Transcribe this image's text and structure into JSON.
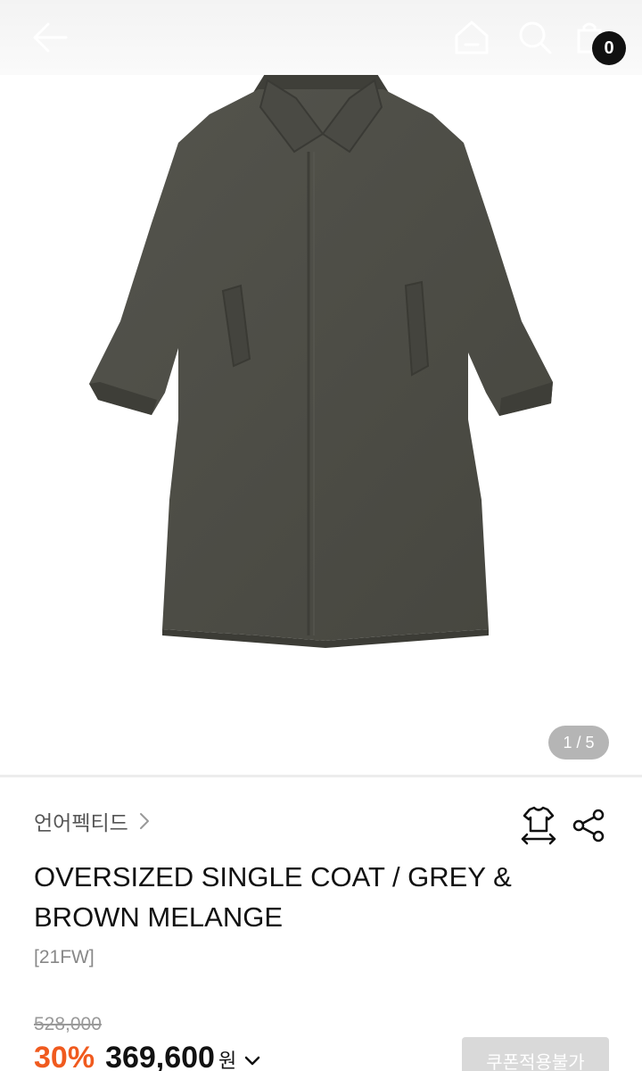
{
  "header": {
    "back_icon": "back-arrow-icon",
    "home_icon": "home-icon",
    "search_icon": "search-icon",
    "bag_icon": "shopping-bag-icon",
    "cart_count": "0"
  },
  "gallery": {
    "pager": "1 / 5",
    "image_subject": "grey coat product photo"
  },
  "product": {
    "brand": "언어펙티드",
    "title": "OVERSIZED SINGLE COAT / GREY & BROWN MELANGE",
    "season": "[21FW]",
    "original_price": "528,000",
    "discount": "30%",
    "price": "369,600",
    "currency": "원",
    "coupon_label": "쿠폰적용불가"
  },
  "colors": {
    "accent_discount": "#f05a1e",
    "coat": "#4e4e48"
  }
}
